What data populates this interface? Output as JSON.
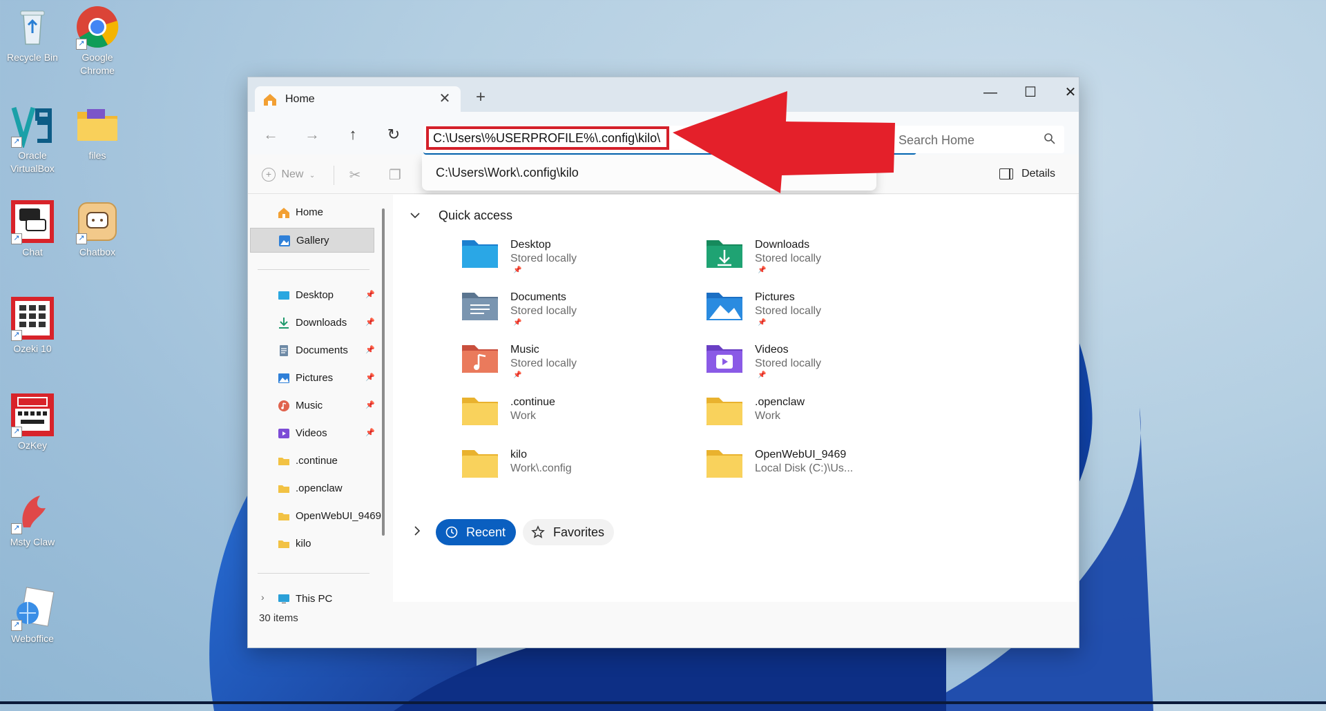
{
  "desktop": {
    "icons": [
      {
        "label": "Recycle Bin"
      },
      {
        "label": "Google Chrome"
      },
      {
        "label": "Oracle VirtualBox"
      },
      {
        "label": "files"
      },
      {
        "label": "Chat"
      },
      {
        "label": "Chatbox"
      },
      {
        "label": "Ozeki 10"
      },
      {
        "label": "OzKey"
      },
      {
        "label": "Msty Claw"
      },
      {
        "label": "Weboffice"
      }
    ]
  },
  "window": {
    "tab_title": "Home",
    "tab_close": "✕",
    "new_tab": "+",
    "minimize": "—",
    "maximize": "☐",
    "close": "✕"
  },
  "navbar": {
    "back": "←",
    "forward": "→",
    "up": "↑",
    "refresh": "↻",
    "address_value": "C:\\Users\\%USERPROFILE%\\.config\\kilo\\",
    "search_placeholder": "Search Home"
  },
  "autocomplete": {
    "suggestion": "C:\\Users\\Work\\.config\\kilo"
  },
  "toolbar": {
    "new_label": "New",
    "details_label": "Details"
  },
  "sidebar": {
    "items": [
      {
        "label": "Home",
        "icon": "home-icon"
      },
      {
        "label": "Gallery",
        "icon": "gallery-icon"
      },
      {
        "label": "Desktop",
        "icon": "desktop-folder-icon",
        "pinned": true
      },
      {
        "label": "Downloads",
        "icon": "downloads-icon",
        "pinned": true
      },
      {
        "label": "Documents",
        "icon": "documents-icon",
        "pinned": true
      },
      {
        "label": "Pictures",
        "icon": "pictures-icon",
        "pinned": true
      },
      {
        "label": "Music",
        "icon": "music-icon",
        "pinned": true
      },
      {
        "label": "Videos",
        "icon": "videos-icon",
        "pinned": true
      },
      {
        "label": ".continue",
        "icon": "folder-icon"
      },
      {
        "label": ".openclaw",
        "icon": "folder-icon"
      },
      {
        "label": "OpenWebUI_9469",
        "icon": "folder-icon"
      },
      {
        "label": "kilo",
        "icon": "folder-icon"
      },
      {
        "label": "This PC",
        "icon": "this-pc-icon"
      }
    ]
  },
  "quick_access": {
    "title": "Quick access",
    "items": [
      {
        "name": "Desktop",
        "sub": "Stored locally"
      },
      {
        "name": "Downloads",
        "sub": "Stored locally"
      },
      {
        "name": "Documents",
        "sub": "Stored locally"
      },
      {
        "name": "Pictures",
        "sub": "Stored locally"
      },
      {
        "name": "Music",
        "sub": "Stored locally"
      },
      {
        "name": "Videos",
        "sub": "Stored locally"
      },
      {
        "name": ".continue",
        "sub": "Work"
      },
      {
        "name": ".openclaw",
        "sub": "Work"
      },
      {
        "name": "kilo",
        "sub": "Work\\.config"
      },
      {
        "name": "OpenWebUI_9469",
        "sub": "Local Disk (C:)\\Us..."
      }
    ]
  },
  "sections": {
    "recent_label": "Recent",
    "favorites_label": "Favorites"
  },
  "status": {
    "item_count": "30 items"
  },
  "colors": {
    "accent": "#0a5fc0",
    "annotation_red": "#e4202a",
    "folder_yellow": "#f7c948"
  }
}
